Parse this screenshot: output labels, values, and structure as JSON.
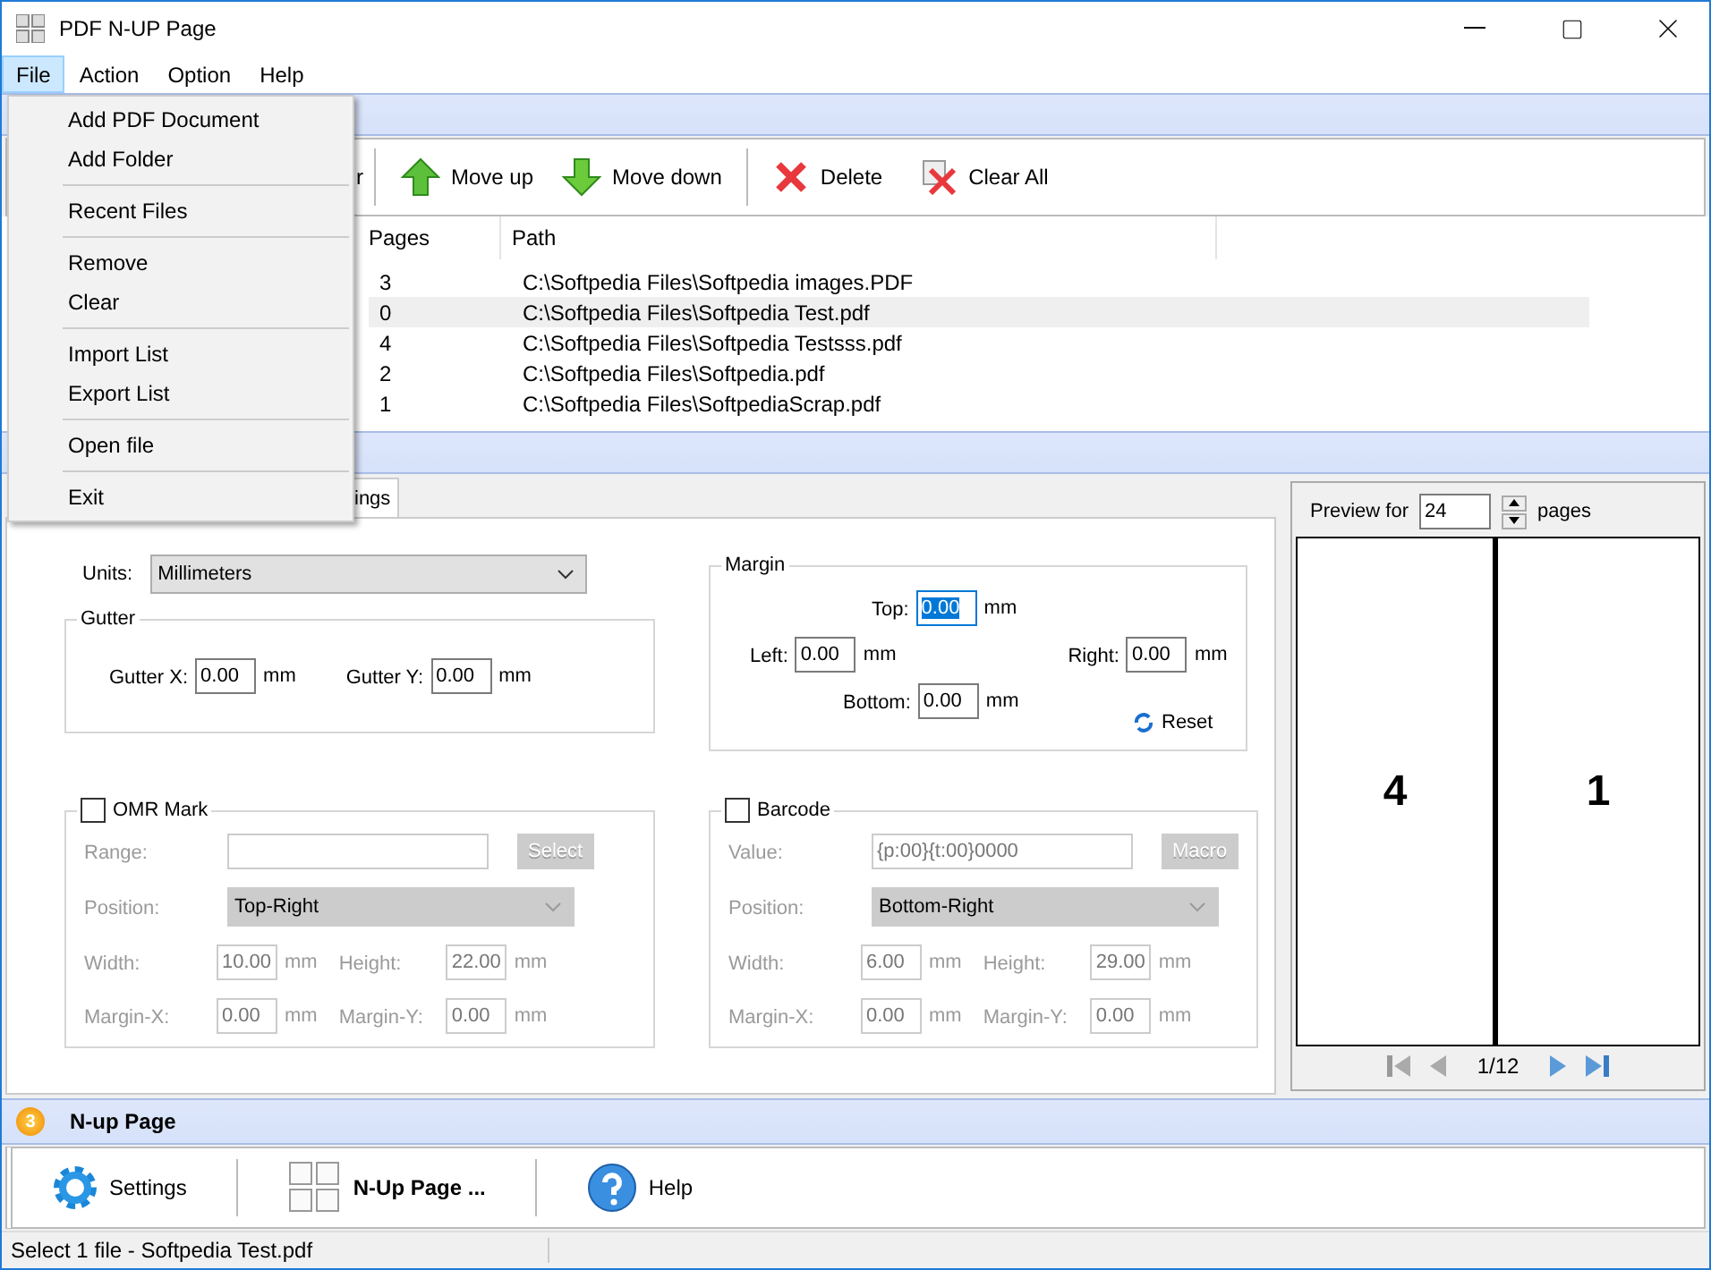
{
  "window": {
    "title": "PDF N-UP Page"
  },
  "menu_bar": [
    {
      "label": "File",
      "selected": true
    },
    {
      "label": "Action",
      "selected": false
    },
    {
      "label": "Option",
      "selected": false
    },
    {
      "label": "Help",
      "selected": false
    }
  ],
  "file_menu": {
    "groups": [
      [
        "Add PDF Document",
        "Add Folder"
      ],
      [
        "Recent Files"
      ],
      [
        "Remove",
        "Clear"
      ],
      [
        "Import List",
        "Export List"
      ],
      [
        "Open file"
      ],
      [
        "Exit"
      ]
    ]
  },
  "toolbar": {
    "partial_label": "r",
    "buttons": [
      {
        "label": "Move up",
        "kind": "up"
      },
      {
        "label": "Move down",
        "kind": "down"
      },
      {
        "label": "Delete",
        "kind": "delete"
      },
      {
        "label": "Clear All",
        "kind": "clear"
      }
    ]
  },
  "file_table": {
    "columns": [
      "Pages",
      "Path"
    ],
    "rows": [
      {
        "pages": "3",
        "path": "C:\\Softpedia Files\\Softpedia images.PDF",
        "selected": false
      },
      {
        "pages": "0",
        "path": "C:\\Softpedia Files\\Softpedia Test.pdf",
        "selected": true
      },
      {
        "pages": "4",
        "path": "C:\\Softpedia Files\\Softpedia Testsss.pdf",
        "selected": false
      },
      {
        "pages": "2",
        "path": "C:\\Softpedia Files\\Softpedia.pdf",
        "selected": false
      },
      {
        "pages": "1",
        "path": "C:\\Softpedia Files\\SoftpediaScrap.pdf",
        "selected": false
      }
    ]
  },
  "settings_tab": {
    "label": "ings",
    "selected": true
  },
  "units": {
    "label": "Units:",
    "value": "Millimeters"
  },
  "gutter": {
    "title": "Gutter",
    "fields": [
      {
        "label": "Gutter X:",
        "value": "0.00",
        "unit": "mm"
      },
      {
        "label": "Gutter Y:",
        "value": "0.00",
        "unit": "mm"
      }
    ]
  },
  "margin": {
    "title": "Margin",
    "top": {
      "label": "Top:",
      "value": "0.00",
      "unit": "mm",
      "focused": true
    },
    "left": {
      "label": "Left:",
      "value": "0.00",
      "unit": "mm",
      "focused": false
    },
    "right": {
      "label": "Right:",
      "value": "0.00",
      "unit": "mm",
      "focused": false
    },
    "bottom": {
      "label": "Bottom:",
      "value": "0.00",
      "unit": "mm",
      "focused": false
    },
    "reset": "Reset"
  },
  "omr": {
    "label": "OMR Mark",
    "checked": false,
    "disabled": true,
    "first_label": "Range:",
    "button": "Select",
    "position_label": "Position:",
    "position": "Top-Right",
    "fields": [
      {
        "label": "Width:",
        "value": "10.00",
        "unit": "mm"
      },
      {
        "label": "Height:",
        "value": "22.00",
        "unit": "mm"
      },
      {
        "label": "Margin-X:",
        "value": "0.00",
        "unit": "mm"
      },
      {
        "label": "Margin-Y:",
        "value": "0.00",
        "unit": "mm"
      }
    ]
  },
  "barcode": {
    "label": "Barcode",
    "checked": false,
    "disabled": true,
    "first_label": "Value:",
    "first_value": "{p:00}{t:00}0000",
    "button": "Macro",
    "position_label": "Position:",
    "position": "Bottom-Right",
    "fields": [
      {
        "label": "Width:",
        "value": "6.00",
        "unit": "mm"
      },
      {
        "label": "Height:",
        "value": "29.00",
        "unit": "mm"
      },
      {
        "label": "Margin-X:",
        "value": "0.00",
        "unit": "mm"
      },
      {
        "label": "Margin-Y:",
        "value": "0.00",
        "unit": "mm"
      }
    ]
  },
  "preview": {
    "label": "Preview for",
    "count": "24",
    "suffix": "pages",
    "pages": [
      "4",
      "1"
    ],
    "page_indicator": "1/12"
  },
  "step3": {
    "badge": "3",
    "title": "N-up Page"
  },
  "actions": [
    {
      "label": "Settings",
      "kind": "settings"
    },
    {
      "label": "N-Up Page ...",
      "kind": "nup"
    },
    {
      "label": "Help",
      "kind": "help"
    }
  ],
  "status_bar": {
    "text": "Select 1 file - Softpedia Test.pdf"
  }
}
